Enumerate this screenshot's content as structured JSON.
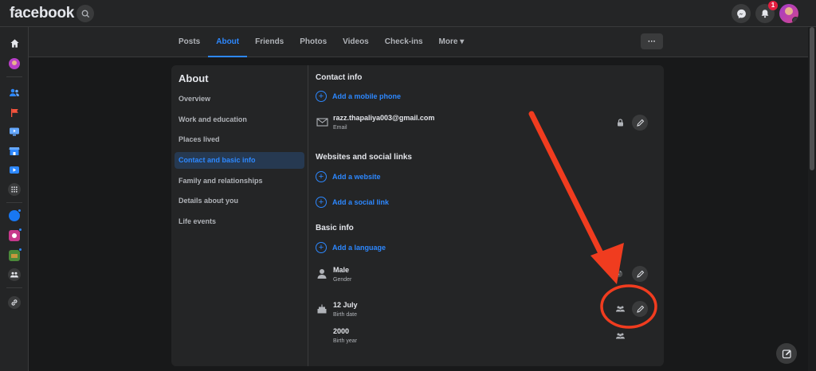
{
  "header": {
    "logo": "facebook",
    "notification_count": "1"
  },
  "tabs": [
    {
      "label": "Posts"
    },
    {
      "label": "About"
    },
    {
      "label": "Friends"
    },
    {
      "label": "Photos"
    },
    {
      "label": "Videos"
    },
    {
      "label": "Check-ins"
    },
    {
      "label": "More ▾"
    }
  ],
  "more_button": "···",
  "about_nav": {
    "title": "About",
    "items": [
      {
        "label": "Overview"
      },
      {
        "label": "Work and education"
      },
      {
        "label": "Places lived"
      },
      {
        "label": "Contact and basic info"
      },
      {
        "label": "Family and relationships"
      },
      {
        "label": "Details about you"
      },
      {
        "label": "Life events"
      }
    ]
  },
  "contact_info": {
    "title": "Contact info",
    "add_phone": "Add a mobile phone",
    "email_value": "razz.thapaliya003@gmail.com",
    "email_label": "Email"
  },
  "websites": {
    "title": "Websites and social links",
    "add_website": "Add a website",
    "add_social": "Add a social link"
  },
  "basic_info": {
    "title": "Basic info",
    "add_language": "Add a language",
    "gender_value": "Male",
    "gender_label": "Gender",
    "birthdate_value": "12 July",
    "birthdate_label": "Birth date",
    "birthyear_value": "2000",
    "birthyear_label": "Birth year"
  },
  "colors": {
    "accent": "#2d88ff",
    "annotation": "#f03c1f",
    "background": "#18191a",
    "surface": "#242526"
  }
}
